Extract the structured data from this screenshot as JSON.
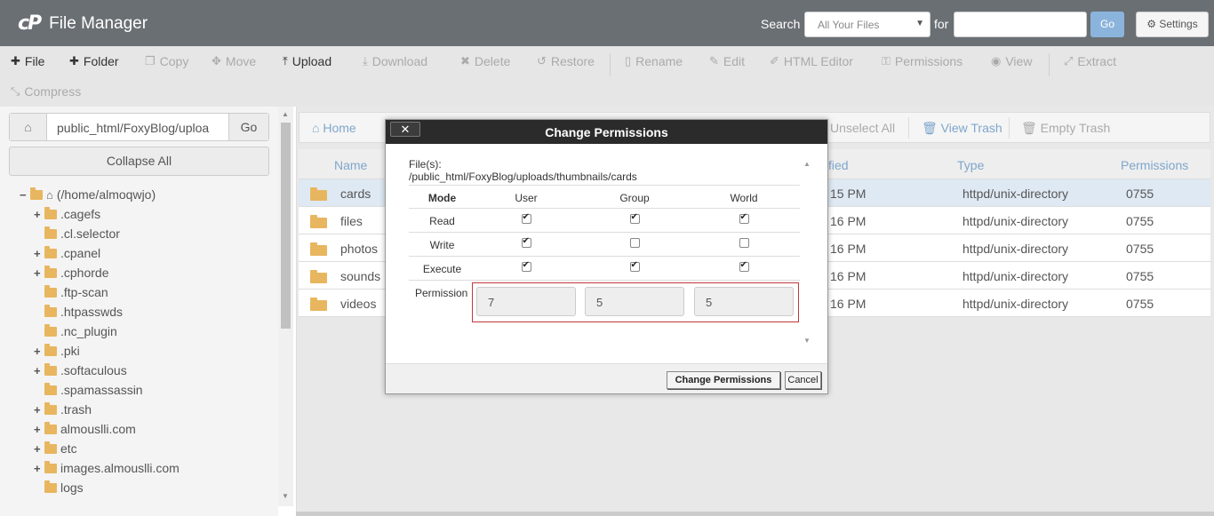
{
  "header": {
    "logo": "cP",
    "title": "File Manager",
    "search_label": "Search",
    "search_scope": "All Your Files",
    "for_label": "for",
    "search_value": "",
    "go_label": "Go",
    "settings_label": "Settings"
  },
  "toolbar": {
    "file": "File",
    "folder": "Folder",
    "copy": "Copy",
    "move": "Move",
    "upload": "Upload",
    "download": "Download",
    "delete": "Delete",
    "restore": "Restore",
    "rename": "Rename",
    "edit": "Edit",
    "html_editor": "HTML Editor",
    "permissions": "Permissions",
    "view": "View",
    "extract": "Extract",
    "compress": "Compress"
  },
  "left": {
    "path": "public_html/FoxyBlog/uploa",
    "go_label": "Go",
    "collapse_label": "Collapse All",
    "tree": [
      {
        "label": "(/home/almoqwjo)",
        "toggle": "−"
      },
      {
        "label": ".cagefs",
        "toggle": "+"
      },
      {
        "label": ".cl.selector",
        "toggle": ""
      },
      {
        "label": ".cpanel",
        "toggle": "+"
      },
      {
        "label": ".cphorde",
        "toggle": "+"
      },
      {
        "label": ".ftp-scan",
        "toggle": ""
      },
      {
        "label": ".htpasswds",
        "toggle": ""
      },
      {
        "label": ".nc_plugin",
        "toggle": ""
      },
      {
        "label": ".pki",
        "toggle": "+"
      },
      {
        "label": ".softaculous",
        "toggle": "+"
      },
      {
        "label": ".spamassassin",
        "toggle": ""
      },
      {
        "label": ".trash",
        "toggle": "+"
      },
      {
        "label": "almouslli.com",
        "toggle": "+"
      },
      {
        "label": "etc",
        "toggle": "+"
      },
      {
        "label": "images.almouslli.com",
        "toggle": "+"
      },
      {
        "label": "logs",
        "toggle": ""
      }
    ]
  },
  "right": {
    "home_label": "Home",
    "unselect_all": "Unselect All",
    "view_trash": "View Trash",
    "empty_trash": "Empty Trash",
    "columns": {
      "name": "Name",
      "modified": "fied",
      "type": "Type",
      "permissions": "Permissions"
    },
    "rows": [
      {
        "name": "cards",
        "modified": "15 PM",
        "type": "httpd/unix-directory",
        "perms": "0755"
      },
      {
        "name": "files",
        "modified": "16 PM",
        "type": "httpd/unix-directory",
        "perms": "0755"
      },
      {
        "name": "photos",
        "modified": "16 PM",
        "type": "httpd/unix-directory",
        "perms": "0755"
      },
      {
        "name": "sounds",
        "modified": "16 PM",
        "type": "httpd/unix-directory",
        "perms": "0755"
      },
      {
        "name": "videos",
        "modified": "16 PM",
        "type": "httpd/unix-directory",
        "perms": "0755"
      }
    ]
  },
  "modal": {
    "title": "Change Permissions",
    "close_label": "✕",
    "files_label": "File(s):",
    "files_path": "/public_html/FoxyBlog/uploads/thumbnails/cards",
    "headers": {
      "mode": "Mode",
      "user": "User",
      "group": "Group",
      "world": "World"
    },
    "rows": [
      {
        "mode": "Read",
        "user": true,
        "group": true,
        "world": true
      },
      {
        "mode": "Write",
        "user": true,
        "group": false,
        "world": false
      },
      {
        "mode": "Execute",
        "user": true,
        "group": true,
        "world": true
      }
    ],
    "permission_label": "Permission",
    "perm_user": "7",
    "perm_group": "5",
    "perm_world": "5",
    "change_button": "Change Permissions",
    "cancel_button": "Cancel"
  }
}
